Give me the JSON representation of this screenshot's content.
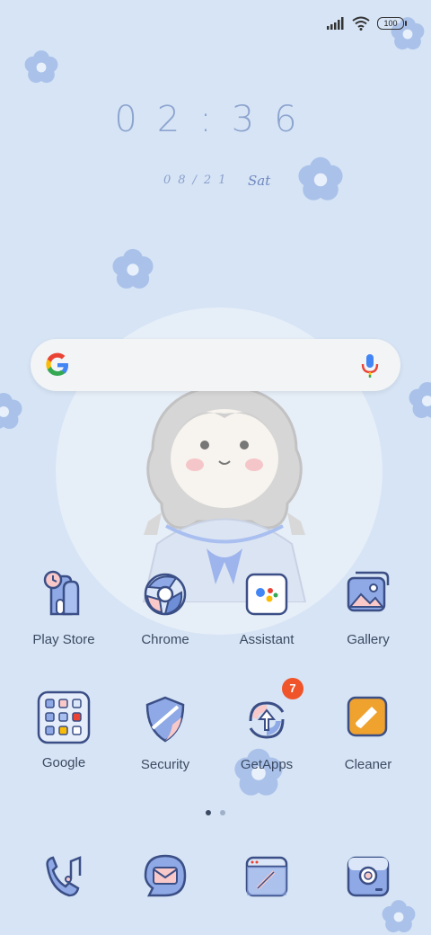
{
  "status_bar": {
    "battery": "100"
  },
  "clock": {
    "time": "02:36",
    "date": "08/21",
    "day": "Sat"
  },
  "search": {
    "google_icon": "google-g-icon",
    "mic_icon": "microphone-icon"
  },
  "apps_row1": [
    {
      "label": "Play Store",
      "icon": "play-store-icon"
    },
    {
      "label": "Chrome",
      "icon": "chrome-icon"
    },
    {
      "label": "Assistant",
      "icon": "assistant-icon"
    },
    {
      "label": "Gallery",
      "icon": "gallery-icon"
    }
  ],
  "apps_row2": [
    {
      "label": "Google",
      "icon": "google-folder-icon"
    },
    {
      "label": "Security",
      "icon": "security-icon"
    },
    {
      "label": "GetApps",
      "icon": "getapps-icon",
      "badge": "7"
    },
    {
      "label": "Cleaner",
      "icon": "cleaner-icon"
    }
  ],
  "dock": [
    {
      "icon": "phone-icon"
    },
    {
      "icon": "messages-icon"
    },
    {
      "icon": "browser-icon"
    },
    {
      "icon": "camera-icon"
    }
  ],
  "page_indicator": {
    "pages": 2,
    "current": 1
  },
  "colors": {
    "background": "#d6e4f5",
    "accent": "#8da4cf",
    "badge": "#f0542a"
  }
}
